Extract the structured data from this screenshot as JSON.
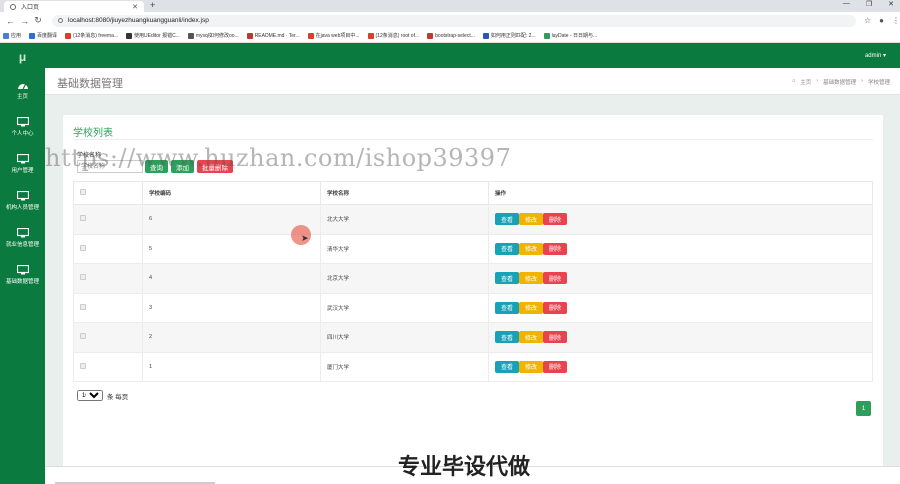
{
  "browser": {
    "tab_title": "入口页",
    "url": "localhost:8080/jiuyezhuangkuangguanli/index.jsp",
    "bookmarks": [
      {
        "label": "应用",
        "color": "#4a7fd4"
      },
      {
        "label": "百度翻译",
        "color": "#2a6fd6"
      },
      {
        "label": "(12条消息) freema...",
        "color": "#d9402b"
      },
      {
        "label": "使用UEditor 报错C...",
        "color": "#333333"
      },
      {
        "label": "mysql如何修改oo...",
        "color": "#555555"
      },
      {
        "label": "README.md · Ter...",
        "color": "#c0392b"
      },
      {
        "label": "在java web项目中...",
        "color": "#d9402b"
      },
      {
        "label": "(12条消息) root of...",
        "color": "#d9402b"
      },
      {
        "label": "bootstrap-select...",
        "color": "#c0392b"
      },
      {
        "label": "如何用正则匹配: 2...",
        "color": "#2a55b8"
      },
      {
        "label": "layDate - 日日期与...",
        "color": "#2e9e5b"
      }
    ]
  },
  "sidebar": {
    "logo": "μ",
    "items": [
      {
        "label": "主页",
        "icon": "dashboard-icon"
      },
      {
        "label": "个人中心",
        "icon": "monitor-icon"
      },
      {
        "label": "用户管理",
        "icon": "monitor-icon"
      },
      {
        "label": "机构人员管理",
        "icon": "monitor-icon"
      },
      {
        "label": "就业信息管理",
        "icon": "monitor-icon"
      },
      {
        "label": "基础数据管理",
        "icon": "monitor-icon"
      }
    ]
  },
  "topbar": {
    "user": "admin ▾"
  },
  "page": {
    "title": "基础数据管理",
    "breadcrumb": [
      "主页",
      "基础数据管理",
      "学校管理"
    ]
  },
  "card": {
    "title": "学校列表",
    "search_label": "学校名称",
    "search_placeholder": "学校名称",
    "buttons": {
      "search": "查询",
      "add": "添加",
      "batch_delete": "批量删除"
    }
  },
  "table": {
    "headers": [
      "",
      "学校编码",
      "学校名称",
      "操作"
    ],
    "rows": [
      {
        "code": "6",
        "name": "北大大学"
      },
      {
        "code": "5",
        "name": "清华大学"
      },
      {
        "code": "4",
        "name": "北京大学"
      },
      {
        "code": "3",
        "name": "武汉大学"
      },
      {
        "code": "2",
        "name": "四川大学"
      },
      {
        "code": "1",
        "name": "厦门大学"
      }
    ],
    "actions": {
      "view": "查看",
      "edit": "修改",
      "delete": "删除"
    }
  },
  "pager": {
    "page_size": "10",
    "per_page_label": "条 每页",
    "current_page": "1"
  },
  "colors": {
    "primary_green": "#0b7a3e",
    "view": "#17a2b8",
    "edit": "#f0b400",
    "delete": "#e8434f",
    "success": "#28a745"
  },
  "overlay": {
    "watermark": "https://www.huzhan.com/ishop39397",
    "promo": "专业毕设代做"
  }
}
